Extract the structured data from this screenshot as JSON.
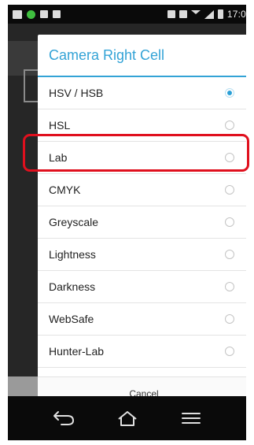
{
  "status_bar": {
    "time": "17:0"
  },
  "dialog": {
    "title": "Camera Right Cell",
    "options": [
      {
        "label": "HSV / HSB",
        "selected": true
      },
      {
        "label": "HSL",
        "selected": false
      },
      {
        "label": "Lab",
        "selected": false
      },
      {
        "label": "CMYK",
        "selected": false
      },
      {
        "label": "Greyscale",
        "selected": false
      },
      {
        "label": "Lightness",
        "selected": false
      },
      {
        "label": "Darkness",
        "selected": false
      },
      {
        "label": "WebSafe",
        "selected": false
      },
      {
        "label": "Hunter-Lab",
        "selected": false
      }
    ],
    "cancel_label": "Cancel"
  },
  "colors": {
    "accent": "#33a3d6",
    "radio_selected": "#2a9fd6",
    "highlight": "#e0101e"
  },
  "icons": {
    "nav_back": "back-arrow-icon",
    "nav_home": "home-icon",
    "nav_menu": "menu-icon"
  }
}
